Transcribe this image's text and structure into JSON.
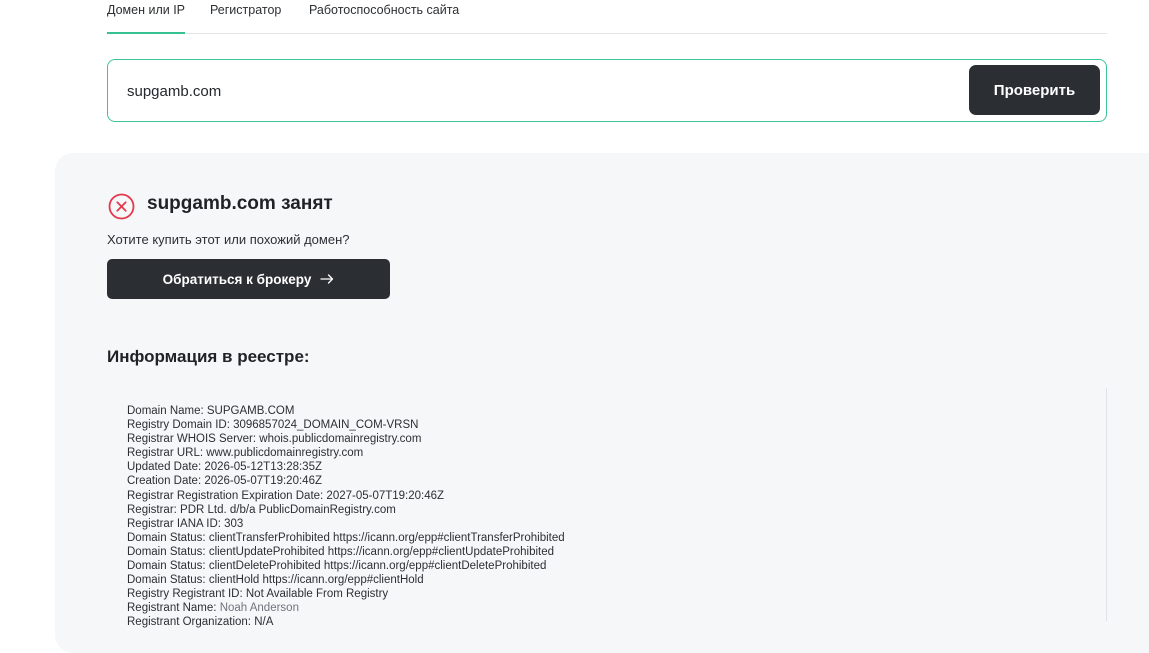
{
  "tabs": [
    {
      "label": "Домен или IP",
      "active": true
    },
    {
      "label": "Регистратор",
      "active": false
    },
    {
      "label": "Работоспособность сайта",
      "active": false
    }
  ],
  "search": {
    "value": "supgamb.com",
    "button_label": "Проверить"
  },
  "result": {
    "title": "supgamb.com занят",
    "question": "Хотите купить этот или похожий домен?",
    "broker_button_label": "Обратиться к брокеру",
    "status_icon": "close-circle-icon",
    "status_color": "#e5384d",
    "accent_color": "#35c190"
  },
  "registry": {
    "heading": "Информация в реестре:",
    "lines": [
      {
        "text": "Domain Name: SUPGAMB.COM"
      },
      {
        "text": "Registry Domain ID: 3096857024_DOMAIN_COM-VRSN"
      },
      {
        "text": "Registrar WHOIS Server: whois.publicdomainregistry.com"
      },
      {
        "text": "Registrar URL: www.publicdomainregistry.com"
      },
      {
        "text": "Updated Date: 2026-05-12T13:28:35Z"
      },
      {
        "text": "Creation Date: 2026-05-07T19:20:46Z"
      },
      {
        "text": "Registrar Registration Expiration Date: 2027-05-07T19:20:46Z"
      },
      {
        "text": "Registrar: PDR Ltd. d/b/a PublicDomainRegistry.com"
      },
      {
        "text": "Registrar IANA ID: 303"
      },
      {
        "text": "Domain Status: clientTransferProhibited https://icann.org/epp#clientTransferProhibited"
      },
      {
        "text": "Domain Status: clientUpdateProhibited https://icann.org/epp#clientUpdateProhibited"
      },
      {
        "text": "Domain Status: clientDeleteProhibited https://icann.org/epp#clientDeleteProhibited"
      },
      {
        "text": "Domain Status: clientHold https://icann.org/epp#clientHold"
      },
      {
        "text": "Registry Registrant ID: Not Available From Registry"
      },
      {
        "label": "Registrant Name: ",
        "value": "Noah Anderson"
      },
      {
        "text": "Registrant Organization: N/A"
      }
    ]
  }
}
